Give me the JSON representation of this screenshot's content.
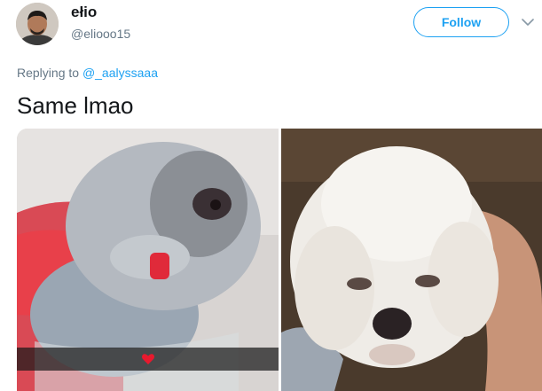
{
  "user": {
    "display_name": "ełio",
    "handle": "@eliooo15"
  },
  "follow_button": {
    "label": "Follow"
  },
  "reply": {
    "prefix": "Replying to",
    "mention": "@_aalyssaaa"
  },
  "tweet": {
    "text": "Same lmao"
  },
  "media": [
    {
      "description_icon": "dog-photo-left",
      "overlay_icon": "heart-icon"
    },
    {
      "description_icon": "dog-photo-right"
    }
  ],
  "colors": {
    "accent": "#1da1f2",
    "secondary_text": "#657786",
    "primary_text": "#14171a"
  }
}
